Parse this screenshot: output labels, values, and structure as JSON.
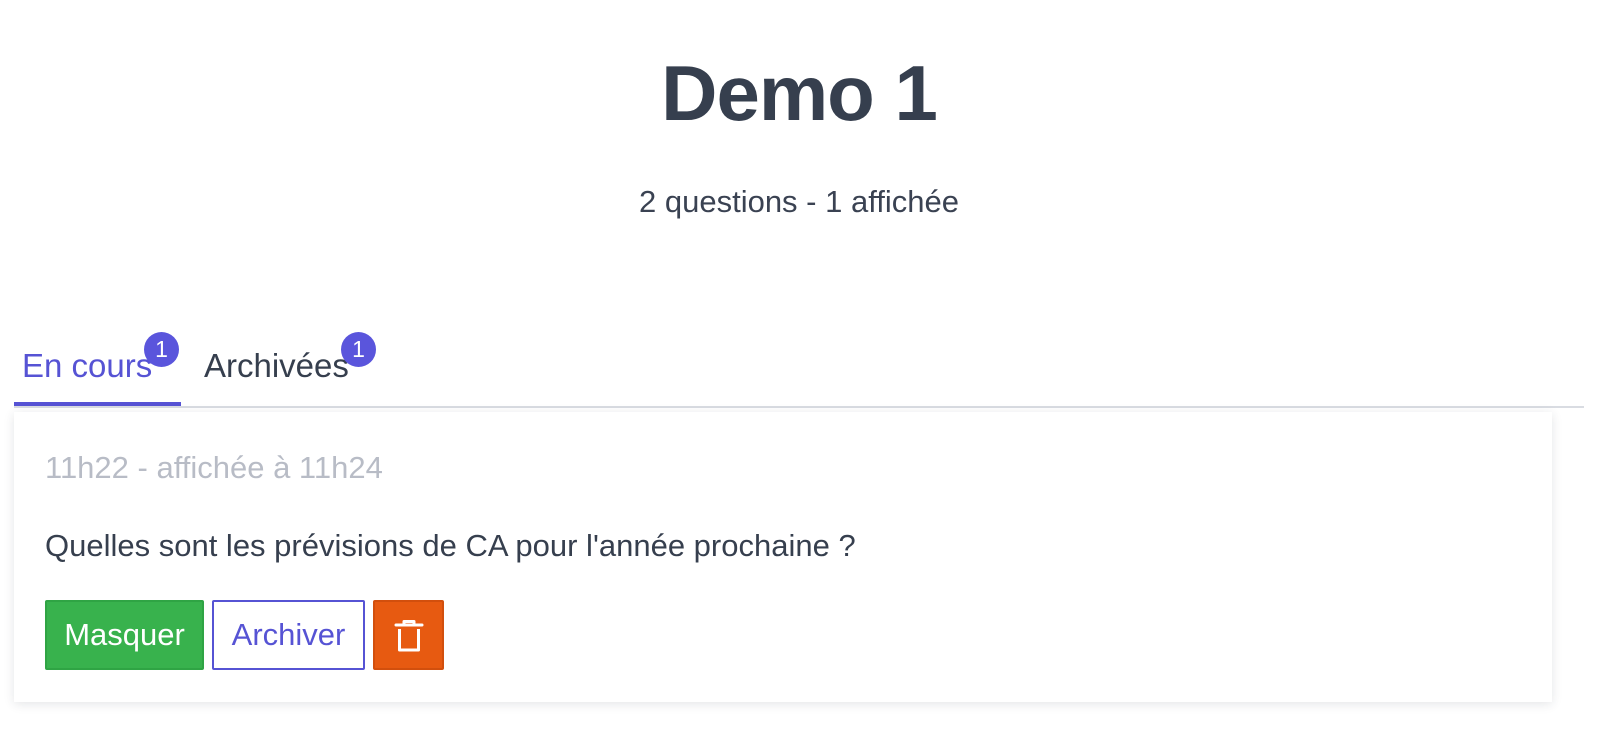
{
  "header": {
    "title": "Demo 1",
    "subtitle": "2 questions - 1 affichée"
  },
  "tabs": [
    {
      "label": "En cours",
      "count": "1",
      "active": true
    },
    {
      "label": "Archivées",
      "count": "1",
      "active": false
    }
  ],
  "questions": [
    {
      "meta": "11h22 - affichée à 11h24",
      "text": "Quelles sont les prévisions de CA pour l'année prochaine ?",
      "actions": {
        "hide_label": "Masquer",
        "archive_label": "Archiver",
        "delete_icon": "trash-icon"
      }
    }
  ],
  "colors": {
    "accent": "#5653d4",
    "badge": "#5a55dc",
    "success": "#38b24d",
    "danger": "#e75a11",
    "muted_text": "#b8bcc6",
    "text": "#363f4e"
  }
}
